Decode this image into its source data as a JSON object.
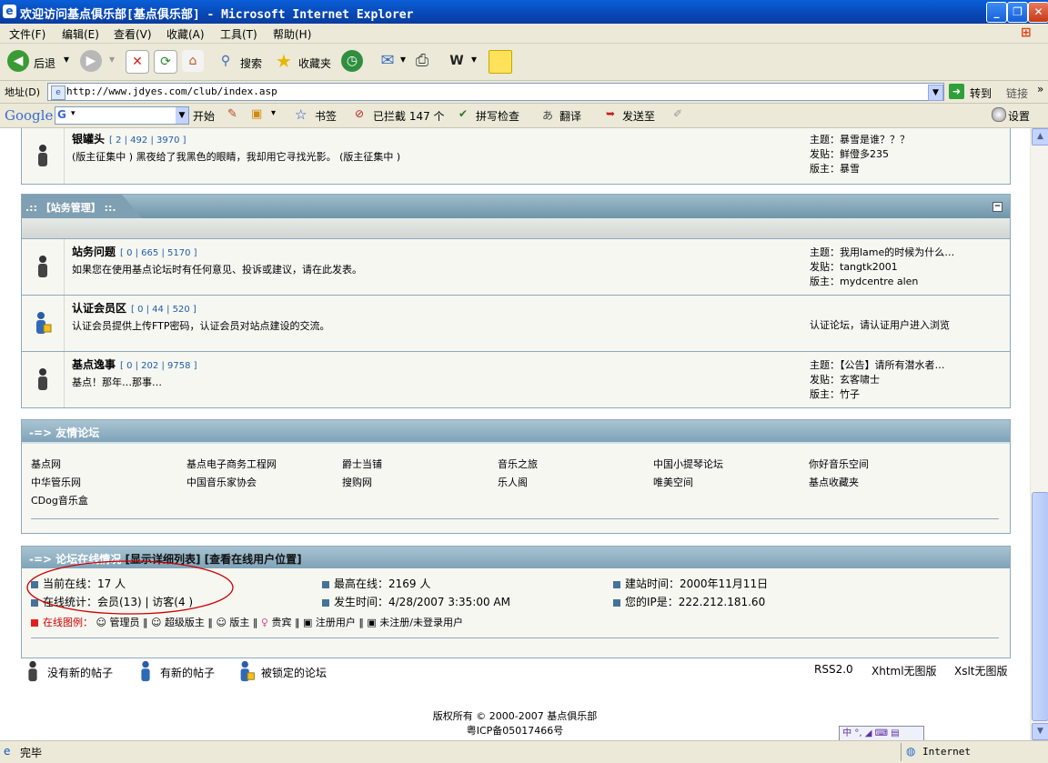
{
  "window": {
    "title": "欢迎访问基点俱乐部[基点俱乐部] - Microsoft Internet Explorer"
  },
  "menu": [
    "文件(F)",
    "编辑(E)",
    "查看(V)",
    "收藏(A)",
    "工具(T)",
    "帮助(H)"
  ],
  "toolbar": {
    "back": "后退",
    "search": "搜索",
    "favorites": "收藏夹"
  },
  "address": {
    "label": "地址(D)",
    "url": "http://www.jdyes.com/club/index.asp",
    "go": "转到",
    "links": "链接"
  },
  "google": {
    "logo": "Google",
    "search_prefix": "G",
    "start": "开始",
    "bookmarks": "书签",
    "blocked": "已拦截 147 个",
    "spell": "拼写检查",
    "translate": "翻译",
    "sendto": "发送至",
    "settings": "设置"
  },
  "forums_top": [
    {
      "name": "银罐头",
      "stats": "[ 2 | 492 | 3970 ]",
      "desc": "(版主征集中 ) 黑夜给了我黑色的眼睛，我却用它寻找光影。 (版主征集中 )",
      "side": [
        "主题：暴雪是谁？？？",
        "发贴：鲜僜多235",
        "版主：暴雪"
      ]
    }
  ],
  "section_admin": {
    "title": ".:: 【站务管理】 ::.",
    "forums": [
      {
        "name": "站务问题",
        "stats": "[ 0 | 665 | 5170 ]",
        "desc": "如果您在使用基点论坛时有任何意见、投诉或建议，请在此发表。",
        "side": [
          "主题：我用lame的时候为什么…",
          "发贴：tangtk2001",
          "版主：mydcentre alen"
        ]
      },
      {
        "name": "认证会员区",
        "stats": "[ 0 | 44 | 520 ]",
        "desc": "认证会员提供上传FTP密码，认证会员对站点建设的交流。",
        "side": [
          "认证论坛，请认证用户进入浏览"
        ]
      },
      {
        "name": "基点逸事",
        "stats": "[ 0 | 202 | 9758 ]",
        "desc": "基点！那年…那事…",
        "side": [
          "主题：【公告】请所有潜水者…",
          "发贴：玄客啸士",
          "版主：竹子"
        ]
      }
    ]
  },
  "friends": {
    "title": "-=> 友情论坛",
    "links": [
      [
        "基点网",
        "基点电子商务工程网",
        "爵士当铺",
        "音乐之旅",
        "中国小提琴论坛",
        "你好音乐空间"
      ],
      [
        "中华管乐网",
        "中国音乐家协会",
        "搜购网",
        "乐人阁",
        "唯美空间",
        "基点收藏夹"
      ],
      [
        "CDog音乐盒"
      ]
    ]
  },
  "online": {
    "title": "-=> 论坛在线情况",
    "show_list": "[显示详细列表]",
    "show_location": "[查看在线用户位置]",
    "current": "当前在线：17 人",
    "stats": "在线统计：会员(13) | 访客(4 )",
    "max_online": "最高在线：2169 人",
    "happened": "发生时间：4/28/2007 3:35:00 AM",
    "built": "建站时间：2000年11月11日",
    "ip": "您的IP是：222.212.181.60",
    "legend_label": "在线图例：",
    "legend": [
      "管理员",
      "超级版主",
      "版主",
      "贵宾",
      "注册用户",
      "未注册/未登录用户"
    ]
  },
  "footer": {
    "no_new": "没有新的帖子",
    "has_new": "有新的帖子",
    "locked": "被锁定的论坛",
    "rss": "RSS2.0",
    "xhtml": "Xhtml无图版",
    "xslt": "Xslt无图版",
    "copyright": "版权所有 © 2000-2007 基点俱乐部",
    "icp": "粤ICP备05017466号"
  },
  "status": {
    "text": "完毕",
    "zone": "Internet"
  },
  "colors": {
    "titlebar": "#0a5fd8",
    "section_header": "#7fa3b8",
    "link_stats": "#1c5ea8",
    "annotation": "#cc0000"
  }
}
